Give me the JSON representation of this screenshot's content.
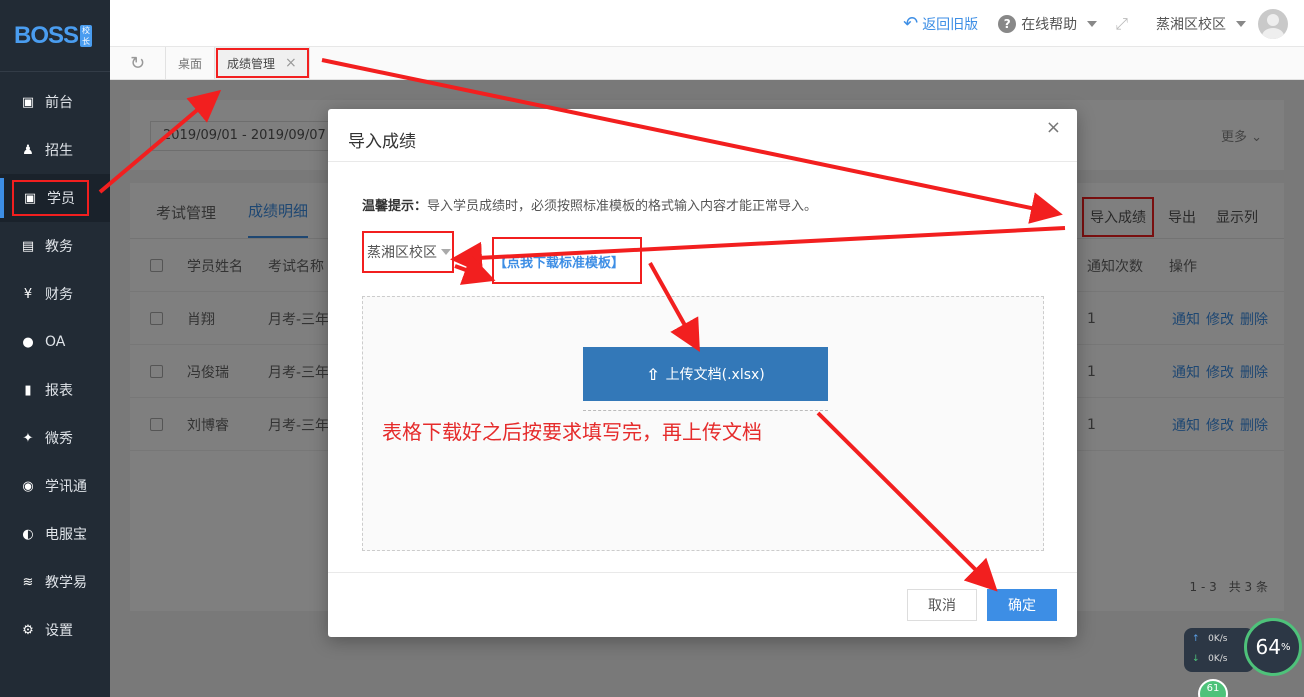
{
  "sidebar": {
    "logo": "BOSS",
    "logo_badge": "校长",
    "items": [
      {
        "label": "前台",
        "icon": "calendar-icon"
      },
      {
        "label": "招生",
        "icon": "add-user-icon"
      },
      {
        "label": "学员",
        "icon": "student-card-icon"
      },
      {
        "label": "教务",
        "icon": "book-icon"
      },
      {
        "label": "财务",
        "icon": "yen-icon"
      },
      {
        "label": "OA",
        "icon": "chat-icon"
      },
      {
        "label": "报表",
        "icon": "bar-chart-icon"
      },
      {
        "label": "微秀",
        "icon": "wechat-show-icon"
      },
      {
        "label": "学讯通",
        "icon": "location-pin-icon"
      },
      {
        "label": "电服宝",
        "icon": "phone-icon"
      },
      {
        "label": "教学易",
        "icon": "teach-icon"
      },
      {
        "label": "设置",
        "icon": "gear-icon"
      }
    ],
    "active_index": 2
  },
  "topbar": {
    "back_label": "返回旧版",
    "help_label": "在线帮助",
    "campus_label": "蒸湘区校区"
  },
  "tabs": {
    "home": "桌面",
    "current": "成绩管理",
    "close": "×"
  },
  "filter": {
    "date_range": "2019/09/01 - 2019/09/07",
    "more": "更多"
  },
  "list": {
    "subtabs": [
      "考试管理",
      "成绩明细"
    ],
    "actions": {
      "import": "导入成绩",
      "export": "导出",
      "columns": "显示列"
    },
    "headers": {
      "name": "学员姓名",
      "exam": "考试名称",
      "notify_count": "通知次数",
      "ops": "操作"
    },
    "rows": [
      {
        "name": "肖翔",
        "exam": "月考-三年",
        "count": "1"
      },
      {
        "name": "冯俊瑞",
        "exam": "月考-三年",
        "count": "1"
      },
      {
        "name": "刘博睿",
        "exam": "月考-三年",
        "count": "1"
      }
    ],
    "row_ops": [
      "通知",
      "修改",
      "删除"
    ],
    "pager": "1 - 3　共 3 条"
  },
  "modal": {
    "title": "导入成绩",
    "close": "×",
    "tip_label": "温馨提示：",
    "tip_text": "导入学员成绩时，必须按照标准模板的格式输入内容才能正常导入。",
    "school": "蒸湘区校区",
    "download_link": "【点我下载标准模板】",
    "upload_label": "上传文档(.xlsx)",
    "annotation": "表格下载好之后按要求填写完，再上传文档",
    "cancel": "取消",
    "ok": "确定"
  },
  "netwidget": {
    "up": "0K/s",
    "down": "0K/s",
    "percent": "64",
    "percent_unit": "%",
    "badge": "61"
  },
  "colors": {
    "accent": "#3d8ee5",
    "sidebar_bg": "#222b35",
    "annotation_red": "#f21f1f"
  }
}
